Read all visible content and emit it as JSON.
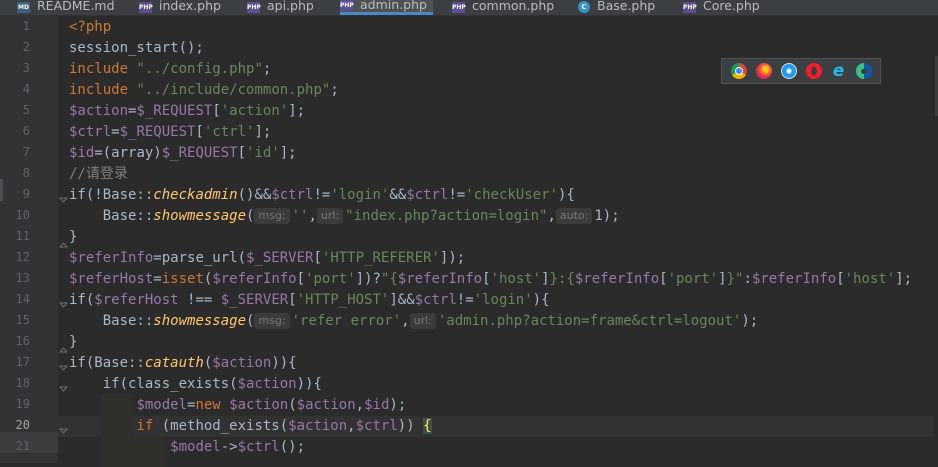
{
  "tabs": [
    {
      "label": "README.md",
      "icon": "markdown-file-icon",
      "badge": "MD",
      "active": false
    },
    {
      "label": "index.php",
      "icon": "php-file-icon",
      "badge": "PHP",
      "active": false
    },
    {
      "label": "api.php",
      "icon": "php-file-icon",
      "badge": "PHP",
      "active": false
    },
    {
      "label": "admin.php",
      "icon": "php-file-icon",
      "badge": "PHP",
      "active": true
    },
    {
      "label": "common.php",
      "icon": "php-file-icon",
      "badge": "PHP",
      "active": false
    },
    {
      "label": "Base.php",
      "icon": "php-class-icon",
      "badge": "C",
      "active": false
    },
    {
      "label": "Core.php",
      "icon": "php-file-icon",
      "badge": "PHP",
      "active": false
    }
  ],
  "line_numbers": [
    "1",
    "2",
    "3",
    "4",
    "5",
    "6",
    "7",
    "8",
    "9",
    "10",
    "11",
    "12",
    "13",
    "14",
    "15",
    "16",
    "17",
    "18",
    "19",
    "20",
    "21"
  ],
  "current_line": "20",
  "hints": {
    "l10_msg": "msg:",
    "l10_url": "url:",
    "l10_auto": "auto:",
    "l15_msg": "msg:",
    "l15_url": "url:"
  },
  "browsers": [
    "chrome-icon",
    "firefox-icon",
    "safari-icon",
    "opera-icon",
    "internet-explorer-icon",
    "edge-icon"
  ],
  "code": {
    "l1": [
      "<?php"
    ],
    "l2": [
      "session_start();"
    ],
    "l3": [
      "include",
      " ",
      "\"../config.php\"",
      ";"
    ],
    "l4": [
      "include",
      " ",
      "\"../include/common.php\"",
      ";"
    ],
    "l5": [
      "$action",
      "=",
      "$_REQUEST",
      "[",
      "'action'",
      "];"
    ],
    "l6": [
      "$ctrl",
      "=",
      "$_REQUEST",
      "[",
      "'ctrl'",
      "];"
    ],
    "l7": [
      "$id",
      "=(array)",
      "$_REQUEST",
      "[",
      "'id'",
      "];"
    ],
    "l8": [
      "//请登录"
    ],
    "l9": [
      "if(!Base::",
      "checkadmin",
      "()&&",
      "$ctrl",
      "!=",
      "'login'",
      "&&",
      "$ctrl",
      "!=",
      "'checkUser'",
      "){"
    ],
    "l10": [
      "    Base::",
      "showmessage",
      "(",
      "''",
      ",",
      "\"index.php?action=login\"",
      ",",
      "1",
      ");"
    ],
    "l11": [
      "}"
    ],
    "l12": [
      "$referInfo",
      "=parse_url(",
      "$_SERVER",
      "[",
      "'HTTP_REFERER'",
      "]);"
    ],
    "l13": [
      "$referHost",
      "=",
      "isset",
      "(",
      "$referInfo",
      "[",
      "'port'",
      "])?",
      "\"{",
      "$referInfo",
      "[",
      "'host'",
      "]",
      "}:{",
      "$referInfo",
      "[",
      "'port'",
      "]",
      "}\"",
      ":",
      "$referInfo",
      "[",
      "'host'",
      "];"
    ],
    "l14": [
      "if(",
      "$referHost",
      " !== ",
      "$_SERVER",
      "[",
      "'HTTP_HOST'",
      "]&&",
      "$ctrl",
      "!=",
      "'login'",
      "){"
    ],
    "l15": [
      "    Base::",
      "showmessage",
      "(",
      "'refer error'",
      ",",
      "'admin.php?action=frame&ctrl=logout'",
      ");"
    ],
    "l16": [
      "}"
    ],
    "l17": [
      "if(Base::",
      "catauth",
      "(",
      "$action",
      ")){"
    ],
    "l18": [
      "    if(class_exists(",
      "$action",
      ")){"
    ],
    "l19": [
      "        ",
      "$model",
      "=",
      "new",
      " ",
      "$action",
      "(",
      "$action",
      ",",
      "$id",
      ");"
    ],
    "l20": [
      "        ",
      "if",
      " (method_exists(",
      "$action",
      ",",
      "$ctrl",
      ")) ",
      "{"
    ],
    "l21": [
      "            ",
      "$model",
      "->",
      "$ctrl",
      "();"
    ]
  },
  "colors": {
    "background": "#2b2b2b",
    "gutter": "#313335",
    "keyword": "#cc7832",
    "string": "#6a8759",
    "variable": "#9876aa",
    "function": "#ffc66d",
    "comment": "#808080",
    "text": "#a9b7c6"
  }
}
